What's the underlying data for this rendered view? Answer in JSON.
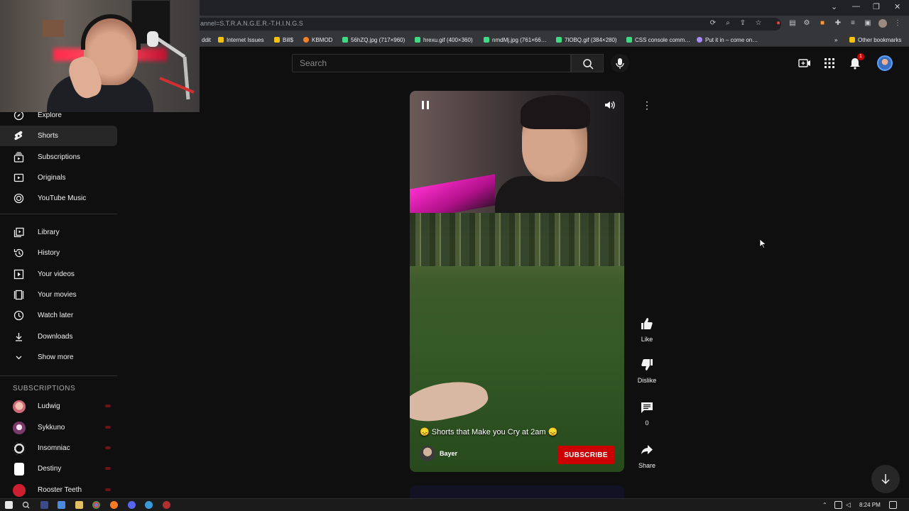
{
  "browser": {
    "url_text": "annel=S.T.R.A.N.G.E.R.-T.H.I.N.G.S",
    "bookmarks": [
      {
        "label": "ddit",
        "color": "#ff4500"
      },
      {
        "label": "Internet Issues",
        "color": "#f4c20d"
      },
      {
        "label": "Bill$",
        "color": "#f4c20d"
      },
      {
        "label": "KBMOD",
        "color": "#f48024"
      },
      {
        "label": "56hZQ.jpg (717×960)",
        "color": "#3ddc84"
      },
      {
        "label": "hrexu.gif (400×360)",
        "color": "#3ddc84"
      },
      {
        "label": "nmdMj.jpg (761×66…",
        "color": "#3ddc84"
      },
      {
        "label": "7lOBQ.gif (384×280)",
        "color": "#3ddc84"
      },
      {
        "label": "CSS console comm…",
        "color": "#3ddc84"
      },
      {
        "label": "Put it in – come on…",
        "color": "#a78bfa"
      }
    ],
    "other_bookmarks": "Other bookmarks"
  },
  "header": {
    "search_placeholder": "Search",
    "notification_count": "1"
  },
  "sidebar": {
    "items": [
      {
        "label": "Explore",
        "icon": "compass-icon"
      },
      {
        "label": "Shorts",
        "icon": "shorts-icon",
        "active": true
      },
      {
        "label": "Subscriptions",
        "icon": "subscriptions-icon"
      },
      {
        "label": "Originals",
        "icon": "originals-icon"
      },
      {
        "label": "YouTube Music",
        "icon": "music-icon"
      }
    ],
    "library_items": [
      {
        "label": "Library",
        "icon": "library-icon"
      },
      {
        "label": "History",
        "icon": "history-icon"
      },
      {
        "label": "Your videos",
        "icon": "your-videos-icon"
      },
      {
        "label": "Your movies",
        "icon": "movies-icon"
      },
      {
        "label": "Watch later",
        "icon": "clock-icon"
      },
      {
        "label": "Downloads",
        "icon": "download-icon"
      },
      {
        "label": "Show more",
        "icon": "chevron-down-icon"
      }
    ],
    "subscriptions_heading": "SUBSCRIPTIONS",
    "subscriptions": [
      {
        "label": "Ludwig",
        "color": "#e8a0a0"
      },
      {
        "label": "Sykkuno",
        "color": "#8b5a7a"
      },
      {
        "label": "Insomniac",
        "color": "#dddddd"
      },
      {
        "label": "Destiny",
        "color": "#ffffff"
      },
      {
        "label": "Rooster Teeth",
        "color": "#cc1f2f"
      }
    ]
  },
  "short": {
    "title": "😞 Shorts that Make you Cry at 2am 😞",
    "channel": "Bayer",
    "subscribe_label": "SUBSCRIBE",
    "actions": {
      "like_label": "Like",
      "dislike_label": "Dislike",
      "comments_count": "0",
      "share_label": "Share"
    }
  },
  "taskbar": {
    "time": "8:24 PM"
  },
  "colors": {
    "accent_red": "#cc0000",
    "background": "#0f0f0f"
  }
}
